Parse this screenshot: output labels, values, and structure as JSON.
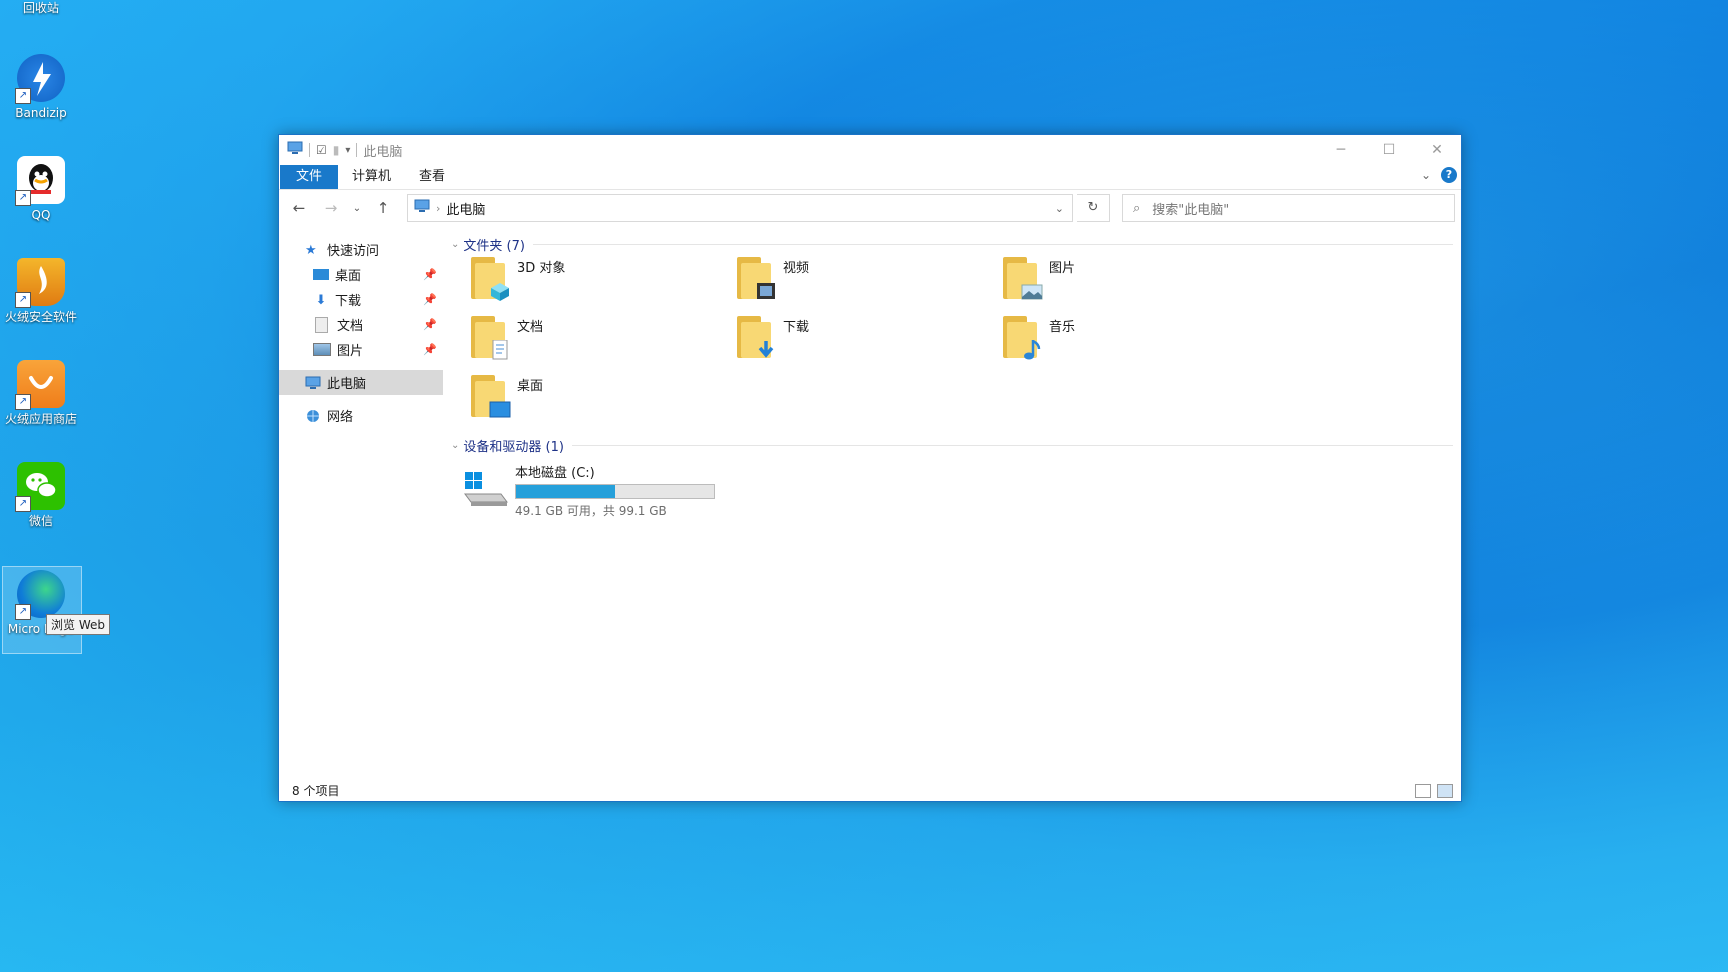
{
  "desktop": {
    "icons": [
      {
        "label": "回收站"
      },
      {
        "label": "Bandizip"
      },
      {
        "label": "QQ"
      },
      {
        "label": "火绒安全软件"
      },
      {
        "label": "火绒应用商店"
      },
      {
        "label": "微信"
      },
      {
        "label": "Micro Edge"
      }
    ],
    "tooltip": "浏览 Web"
  },
  "window": {
    "title": "此电脑",
    "tabs": [
      "文件",
      "计算机",
      "查看"
    ],
    "address": "此电脑",
    "search_placeholder": "搜索\"此电脑\"",
    "sidebar": {
      "quick_access": "快速访问",
      "items": [
        "桌面",
        "下载",
        "文档",
        "图片"
      ],
      "this_pc": "此电脑",
      "network": "网络"
    },
    "folders_header": "文件夹 (7)",
    "folders": [
      "3D 对象",
      "视频",
      "图片",
      "文档",
      "下载",
      "音乐",
      "桌面"
    ],
    "devices_header": "设备和驱动器 (1)",
    "drive": {
      "name": "本地磁盘 (C:)",
      "space": "49.1 GB 可用，共 99.1 GB",
      "used_fraction": 0.5
    },
    "status": "8 个项目"
  }
}
